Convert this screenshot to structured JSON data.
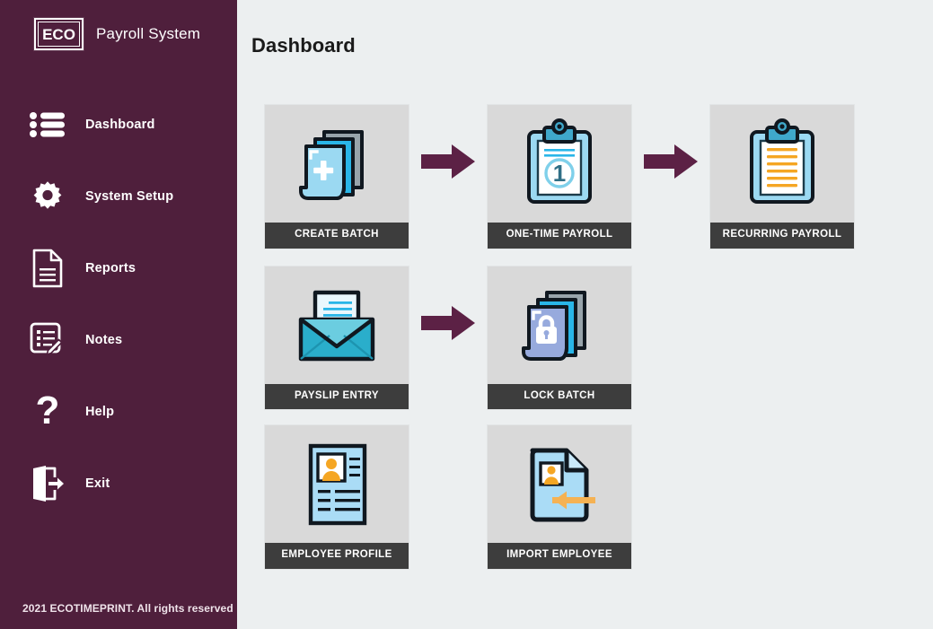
{
  "sidebar": {
    "logo_text": "ECO",
    "brand_title": "Payroll System",
    "items": [
      {
        "label": "Dashboard",
        "icon": "list-icon",
        "name": "sidebar-item-dashboard"
      },
      {
        "label": "System  Setup",
        "icon": "gear-icon",
        "name": "sidebar-item-system-setup"
      },
      {
        "label": "Reports",
        "icon": "document-icon",
        "name": "sidebar-item-reports"
      },
      {
        "label": "Notes",
        "icon": "notes-pencil-icon",
        "name": "sidebar-item-notes"
      },
      {
        "label": "Help",
        "icon": "question-mark-icon",
        "name": "sidebar-item-help"
      },
      {
        "label": "Exit",
        "icon": "exit-door-icon",
        "name": "sidebar-item-exit"
      }
    ],
    "footer": "2021 ECOTIMEPRINT. All rights reserved"
  },
  "header": {
    "title": "Dashboard"
  },
  "colors": {
    "sidebar_bg": "#4f1f3c",
    "page_bg": "#eceff0",
    "card_icon_bg": "#d9d9d9",
    "card_label_bg": "#3d3d3d",
    "arrow": "#5c2145",
    "accent_blue": "#5bc8e8",
    "accent_orange": "#f5a623"
  },
  "cards": {
    "create_batch": {
      "label": "CREATE BATCH",
      "icon": "stacked-documents-plus-icon"
    },
    "one_time_payroll": {
      "label": "ONE-TIME PAYROLL",
      "icon": "clipboard-one-icon"
    },
    "recurring_payroll": {
      "label": "RECURRING PAYROLL",
      "icon": "clipboard-lines-icon"
    },
    "payslip_entry": {
      "label": "PAYSLIP ENTRY",
      "icon": "envelope-document-icon"
    },
    "lock_batch": {
      "label": "LOCK BATCH",
      "icon": "stacked-documents-lock-icon"
    },
    "employee_profile": {
      "label": "EMPLOYEE PROFILE",
      "icon": "id-card-icon"
    },
    "import_employee": {
      "label": "IMPORT EMPLOYEE",
      "icon": "document-import-arrow-icon"
    }
  },
  "flow_arrows": {
    "arrow_1": "arrow-right-icon",
    "arrow_2": "arrow-right-icon",
    "arrow_3": "arrow-right-icon"
  }
}
